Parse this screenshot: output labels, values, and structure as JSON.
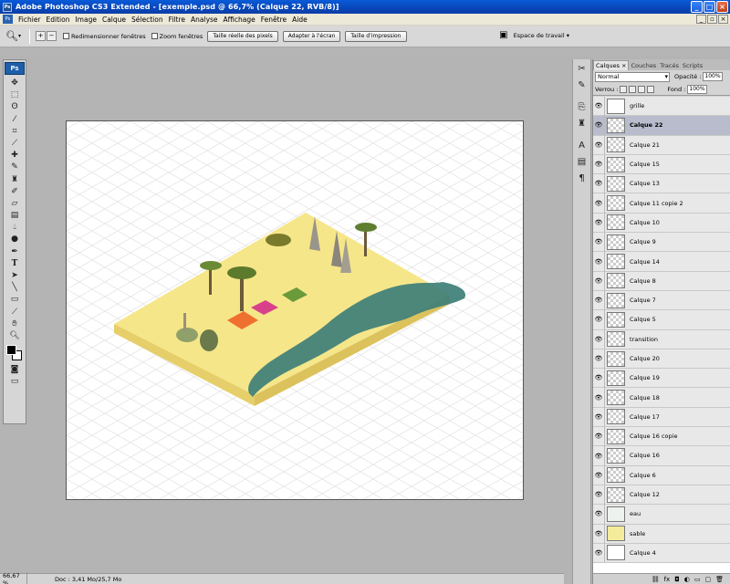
{
  "window": {
    "title": "Adobe Photoshop CS3 Extended - [exemple.psd @ 66,7% (Calque 22, RVB/8)]",
    "app_icon": "Ps"
  },
  "menu": [
    "Fichier",
    "Edition",
    "Image",
    "Calque",
    "Sélection",
    "Filtre",
    "Analyse",
    "Affichage",
    "Fenêtre",
    "Aide"
  ],
  "options": {
    "resize_windows": "Redimensionner fenêtres",
    "zoom_windows": "Zoom fenêtres",
    "actual_pixels": "Taille réelle des pixels",
    "fit_screen": "Adapter à l'écran",
    "print_size": "Taille d'impression",
    "workspace": "Espace de travail"
  },
  "toolbox": {
    "logo": "Ps",
    "tools": [
      "move-tool",
      "marquee-tool",
      "lasso-tool",
      "magic-wand-tool",
      "crop-tool",
      "slice-tool",
      "healing-brush-tool",
      "brush-tool",
      "clone-stamp-tool",
      "history-brush-tool",
      "eraser-tool",
      "gradient-tool",
      "blur-tool",
      "dodge-tool",
      "pen-tool",
      "type-tool",
      "path-selection-tool",
      "line-tool",
      "notes-tool",
      "eyedropper-tool",
      "hand-tool",
      "zoom-tool"
    ]
  },
  "status": {
    "zoom": "66,67 %",
    "doc": "Doc : 3,41 Mo/25,7 Mo"
  },
  "layers_panel": {
    "tabs": [
      "Calques",
      "Couches",
      "Tracés",
      "Scripts"
    ],
    "blend_mode": "Normal",
    "opacity_label": "Opacité :",
    "opacity_value": "100%",
    "lock_label": "Verrou :",
    "fill_label": "Fond :",
    "fill_value": "100%",
    "layers": [
      {
        "name": "grille",
        "thumb": "white",
        "selected": false
      },
      {
        "name": "Calque 22",
        "thumb": "checker",
        "selected": true
      },
      {
        "name": "Calque 21",
        "thumb": "checker",
        "selected": false
      },
      {
        "name": "Calque 15",
        "thumb": "checker",
        "selected": false
      },
      {
        "name": "Calque 13",
        "thumb": "checker",
        "selected": false
      },
      {
        "name": "Calque 11 copie 2",
        "thumb": "checker",
        "selected": false
      },
      {
        "name": "Calque 10",
        "thumb": "checker",
        "selected": false
      },
      {
        "name": "Calque 9",
        "thumb": "checker",
        "selected": false
      },
      {
        "name": "Calque 14",
        "thumb": "checker",
        "selected": false
      },
      {
        "name": "Calque 8",
        "thumb": "checker",
        "selected": false
      },
      {
        "name": "Calque 7",
        "thumb": "checker",
        "selected": false
      },
      {
        "name": "Calque 5",
        "thumb": "checker",
        "selected": false
      },
      {
        "name": "transition",
        "thumb": "checker",
        "selected": false
      },
      {
        "name": "Calque 20",
        "thumb": "checker",
        "selected": false
      },
      {
        "name": "Calque 19",
        "thumb": "checker",
        "selected": false
      },
      {
        "name": "Calque 18",
        "thumb": "checker",
        "selected": false
      },
      {
        "name": "Calque 17",
        "thumb": "checker",
        "selected": false
      },
      {
        "name": "Calque 16 copie",
        "thumb": "checker",
        "selected": false
      },
      {
        "name": "Calque 16",
        "thumb": "checker",
        "selected": false
      },
      {
        "name": "Calque 6",
        "thumb": "checker",
        "selected": false
      },
      {
        "name": "Calque 12",
        "thumb": "checker",
        "selected": false
      },
      {
        "name": "eau",
        "thumb": "eau",
        "selected": false
      },
      {
        "name": "sable",
        "thumb": "sable",
        "selected": false
      },
      {
        "name": "Calque 4",
        "thumb": "white",
        "selected": false
      }
    ]
  },
  "colors": {
    "sand": "#f6e68a",
    "sand_side": "#e6cf6a",
    "water": "#3e7f78",
    "grid": "#dcdcdc"
  }
}
